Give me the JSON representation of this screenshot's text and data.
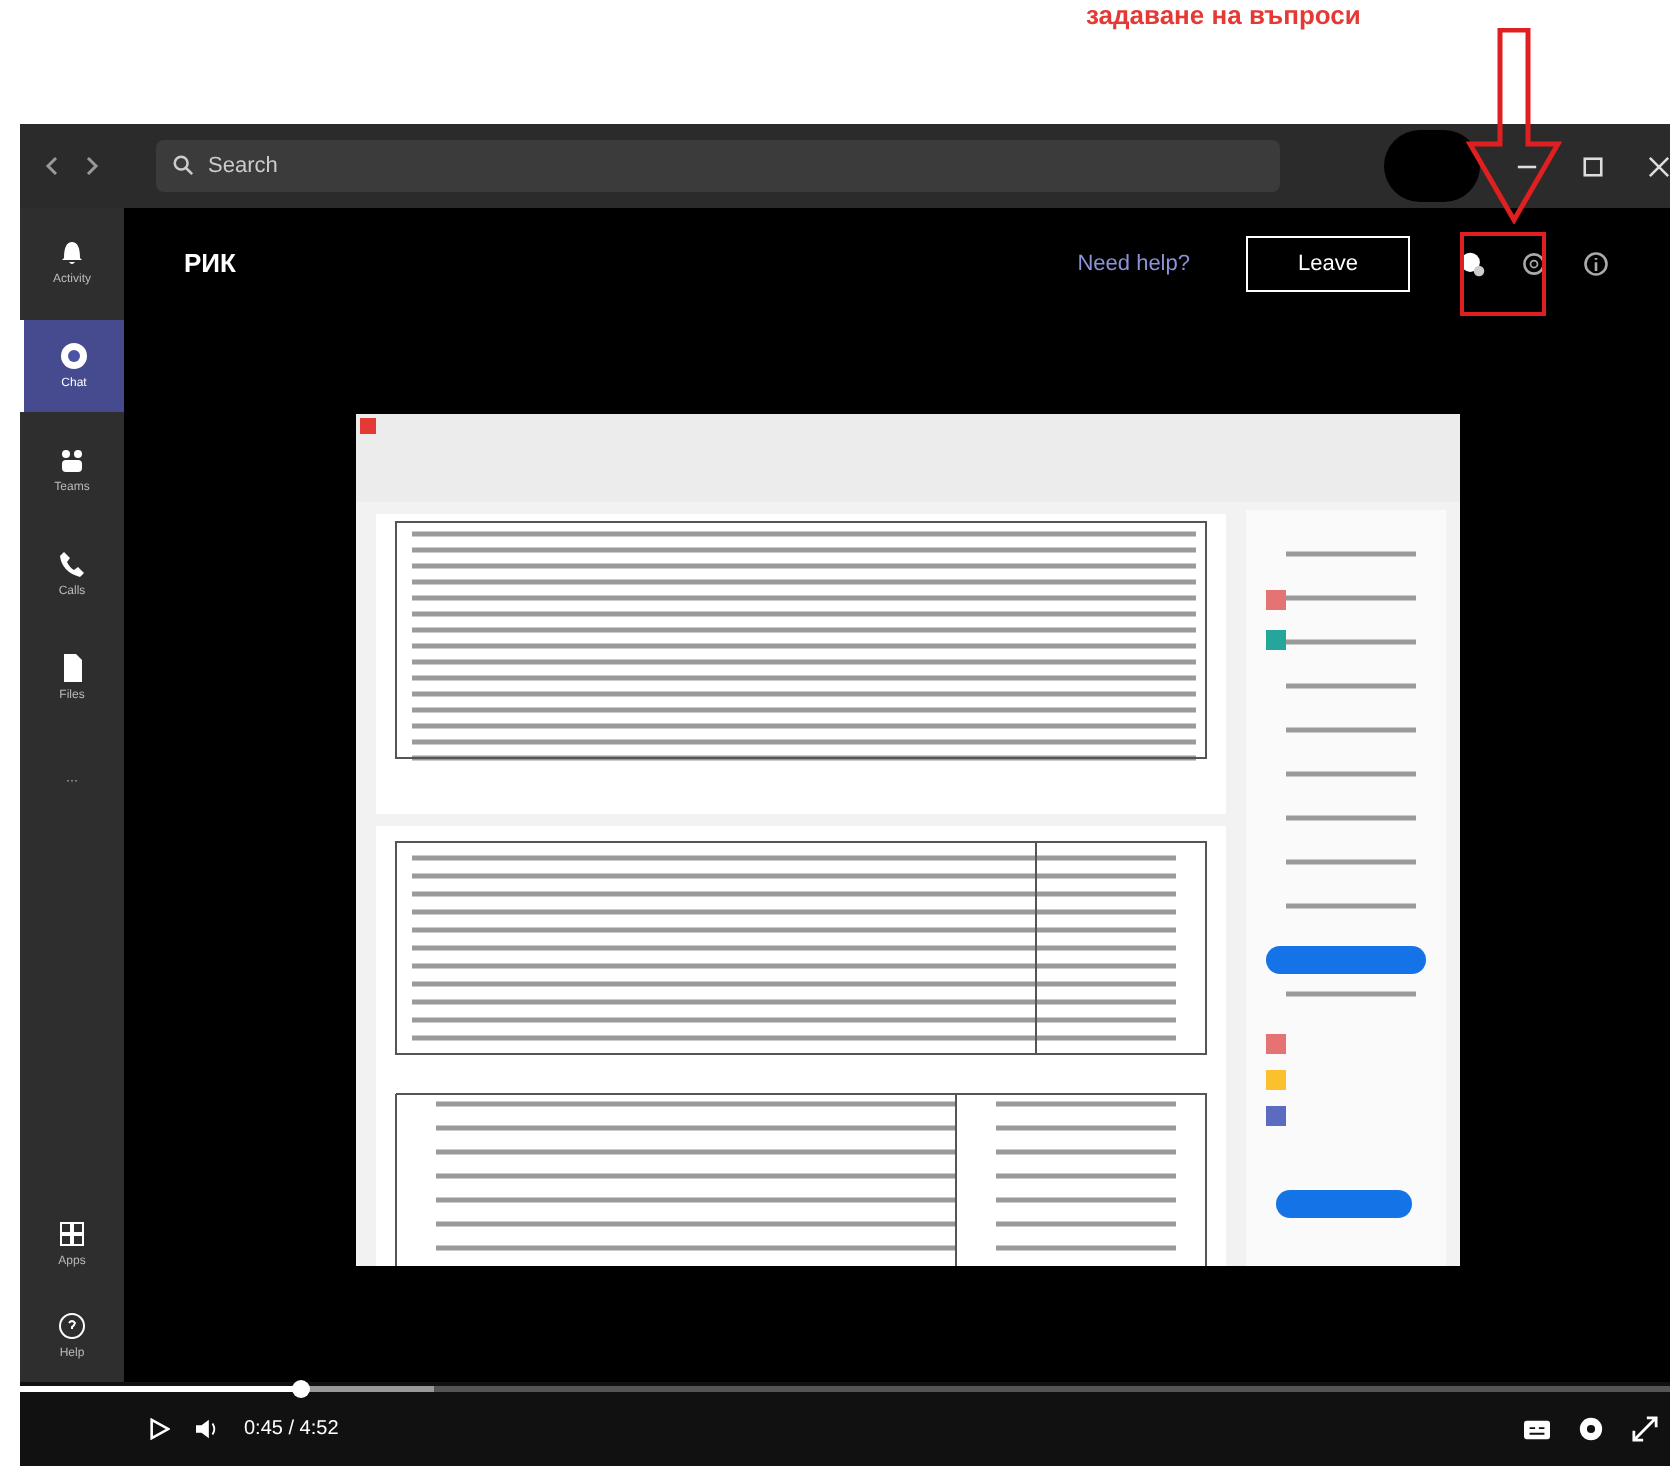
{
  "annotation": {
    "caption": "задаване на въпроси"
  },
  "title_bar": {
    "search": {
      "placeholder": "Search"
    }
  },
  "sidebar": {
    "items": [
      {
        "kind": "bell",
        "label": "Activity",
        "selected": false
      },
      {
        "kind": "chat",
        "label": "Chat",
        "selected": true
      },
      {
        "kind": "teams",
        "label": "Teams",
        "selected": false
      },
      {
        "kind": "calls",
        "label": "Calls",
        "selected": false
      },
      {
        "kind": "files",
        "label": "Files",
        "selected": false
      },
      {
        "kind": "more",
        "label": "···",
        "selected": false
      }
    ],
    "bottom_items": [
      {
        "kind": "apps",
        "label": "Apps",
        "selected": false
      },
      {
        "kind": "help",
        "label": "Help",
        "selected": false
      }
    ]
  },
  "meeting": {
    "title": "РИК",
    "help_link": "Need help?",
    "leave_button": "Leave"
  },
  "player": {
    "level": 0.17,
    "time": "0:45 / 4:52"
  }
}
